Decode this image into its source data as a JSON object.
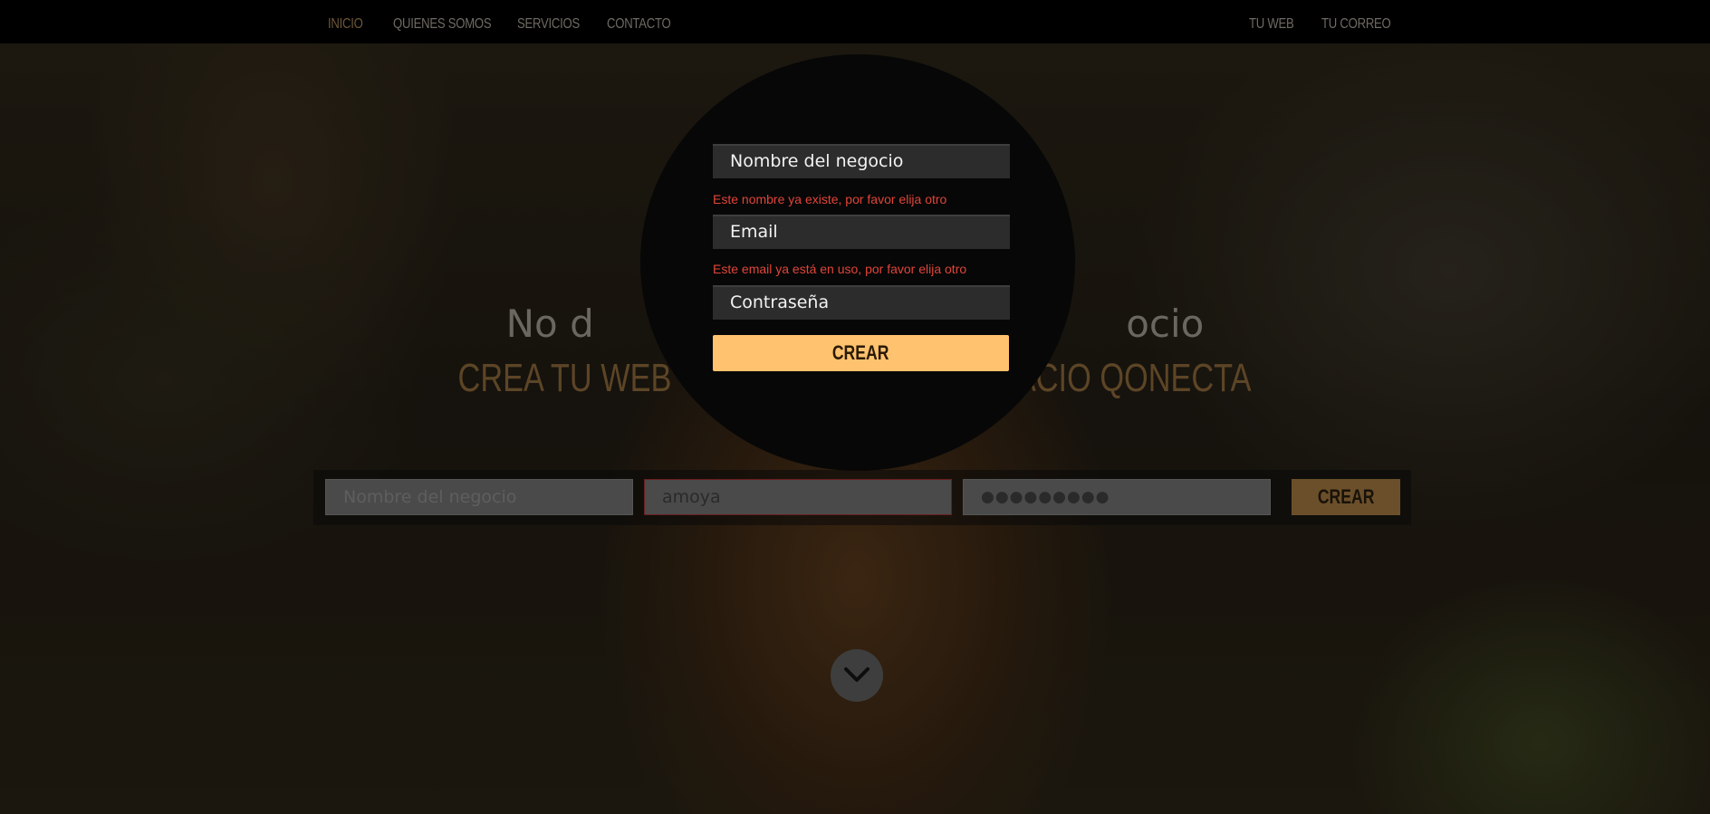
{
  "nav": {
    "left": [
      "INICIO",
      "QUIENES SOMOS",
      "SERVICIOS",
      "CONTACTO"
    ],
    "right": [
      "TU WEB",
      "TU CORREO"
    ],
    "active": "INICIO"
  },
  "hero": {
    "title_visible": "No d                                            ocio",
    "subtitle_visible": "CREA TU WEB                                        ACIO QONECTA"
  },
  "modal": {
    "name_field": "Nombre del negocio",
    "name_error": "Este nombre ya existe, por favor elija otro",
    "email_field": "Email",
    "email_error": "Este email ya está en uso, por favor elija otro",
    "password_field": "Contraseña",
    "submit_label": "CREAR"
  },
  "bar": {
    "name_placeholder": "Nombre del negocio",
    "email_value": "amoya",
    "password_value": "●●●●●●●●●",
    "submit_label": "CREAR"
  },
  "icons": {
    "scroll": "chevron-down-icon"
  },
  "colors": {
    "accent": "#ffc26e",
    "error": "#e0453a",
    "nav_bg": "#000000"
  }
}
